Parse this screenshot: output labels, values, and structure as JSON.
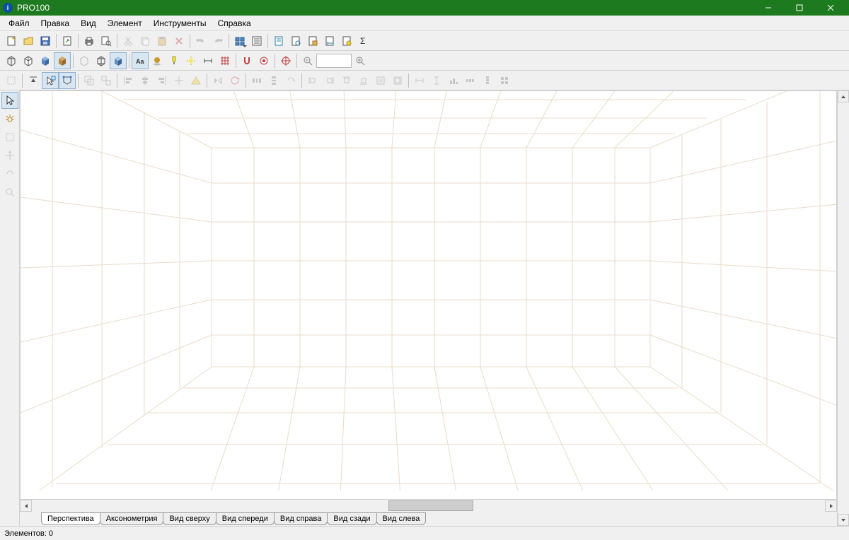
{
  "window": {
    "title": "PRO100"
  },
  "menu": {
    "file": "Файл",
    "edit": "Правка",
    "view": "Вид",
    "element": "Элемент",
    "tools": "Инструменты",
    "help": "Справка"
  },
  "toolbar1": {
    "zoom_input": ""
  },
  "view_tabs": {
    "perspective": "Перспектива",
    "axonometry": "Аксонометрия",
    "top": "Вид сверху",
    "front": "Вид спереди",
    "right": "Вид справа",
    "back": "Вид сзади",
    "left": "Вид слева"
  },
  "status": {
    "elements": "Элементов: 0"
  }
}
